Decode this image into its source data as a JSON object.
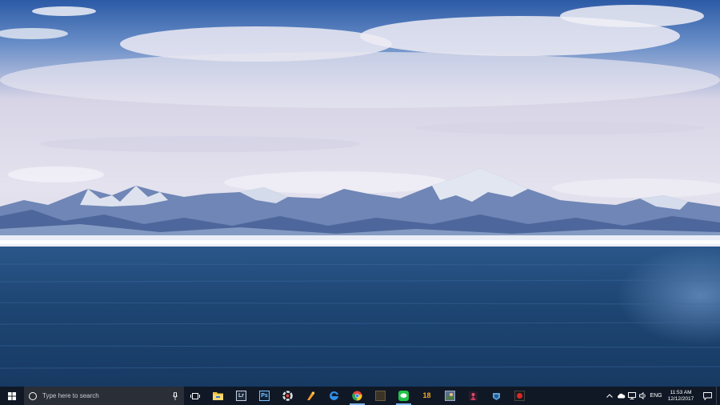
{
  "search": {
    "placeholder": "Type here to search"
  },
  "taskbar": {
    "apps": [
      {
        "name": "file-explorer",
        "label": ""
      },
      {
        "name": "lightroom",
        "label": "Lr"
      },
      {
        "name": "photoshop",
        "label": "Ps"
      },
      {
        "name": "app-ring",
        "label": ""
      },
      {
        "name": "app-flare",
        "label": ""
      },
      {
        "name": "edge",
        "label": ""
      },
      {
        "name": "chrome",
        "label": ""
      },
      {
        "name": "app-dark",
        "label": ""
      },
      {
        "name": "line",
        "label": ""
      },
      {
        "name": "app-18",
        "label": "18"
      },
      {
        "name": "app-game",
        "label": ""
      },
      {
        "name": "app-figure",
        "label": ""
      },
      {
        "name": "steam",
        "label": ""
      },
      {
        "name": "app-red",
        "label": ""
      }
    ]
  },
  "tray": {
    "language": "ENG",
    "time": "11:53 AM",
    "date": "12/12/2017"
  },
  "colors": {
    "taskbar": "#101826",
    "sky": "#2b5aa8",
    "sea": "#1d4470"
  }
}
